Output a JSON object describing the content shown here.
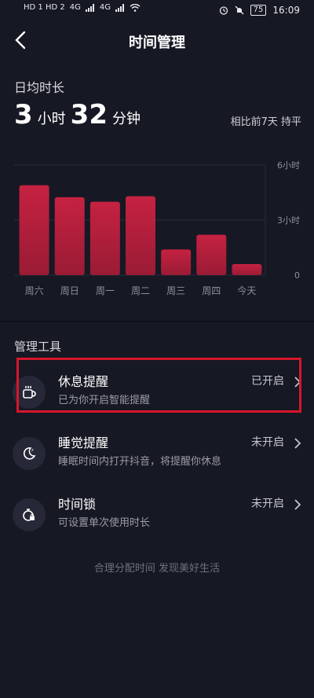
{
  "status_bar": {
    "left": "HD 1 HD 2",
    "signal_1": "4G",
    "signal_2": "4G",
    "battery": "75",
    "time": "16:09"
  },
  "header": {
    "title": "时间管理"
  },
  "summary": {
    "label": "日均时长",
    "hours": "3",
    "hours_unit": "小时",
    "minutes": "32",
    "minutes_unit": "分钟",
    "compare": "相比前7天 持平"
  },
  "chart_data": {
    "type": "bar",
    "categories": [
      "周六",
      "周日",
      "周一",
      "周二",
      "周三",
      "周四",
      "今天"
    ],
    "values": [
      4.9,
      4.25,
      4.0,
      4.3,
      1.4,
      2.2,
      0.6
    ],
    "ylim": [
      0,
      6
    ],
    "ytick_labels": [
      "6小时",
      "3小时",
      "0"
    ],
    "ytick_values": [
      6,
      3,
      0
    ],
    "grid": true,
    "colors": {
      "bar": "#9a1b35",
      "bar_top": "#c52241",
      "grid": "#2a2c3a"
    }
  },
  "tools": {
    "title": "管理工具",
    "items": [
      {
        "name": "休息提醒",
        "desc": "已为你开启智能提醒",
        "status": "已开启",
        "icon": "coffee-cup-icon"
      },
      {
        "name": "睡觉提醒",
        "desc": "睡眠时间内打开抖音，将提醒你休息",
        "status": "未开启",
        "icon": "moon-icon"
      },
      {
        "name": "时间锁",
        "desc": "可设置单次使用时长",
        "status": "未开启",
        "icon": "lock-timer-icon"
      }
    ]
  },
  "footer": "合理分配时间 发现美好生活",
  "colors": {
    "background": "#161824",
    "highlight": "#d6162b"
  }
}
